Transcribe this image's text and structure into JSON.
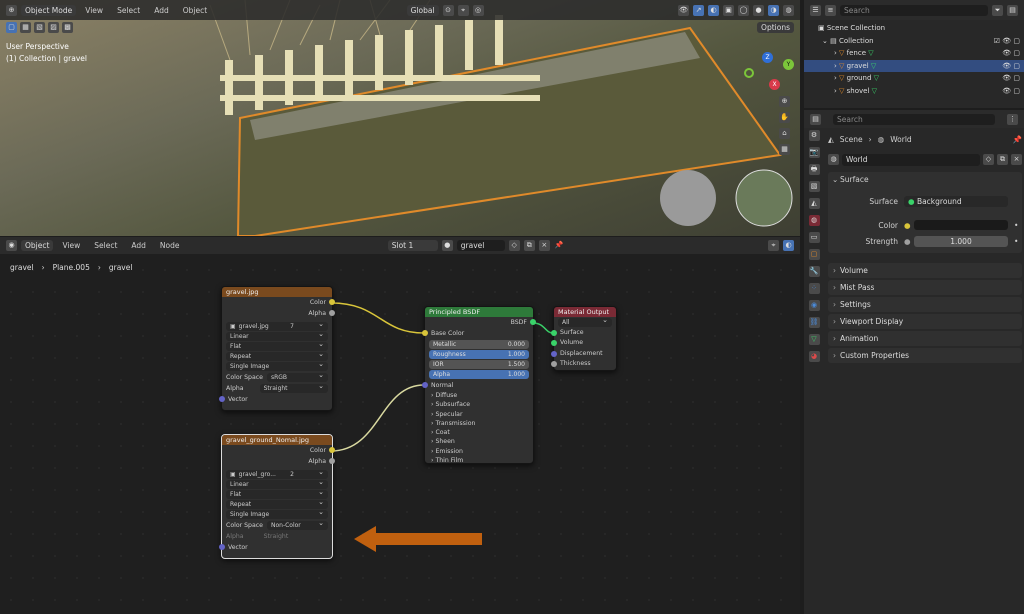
{
  "viewport": {
    "mode": "Object Mode",
    "menus": [
      "View",
      "Select",
      "Add",
      "Object"
    ],
    "transform": "Global",
    "options": "Options",
    "overlay_line1": "User Perspective",
    "overlay_line2": "(1) Collection | gravel",
    "gizmo": {
      "z": "Z",
      "y": "Y",
      "x": "X"
    }
  },
  "node_editor": {
    "editor_type": "Object",
    "menus": [
      "View",
      "Select",
      "Add",
      "Node"
    ],
    "slot": "Slot 1",
    "material": "gravel",
    "breadcrumb": [
      "gravel",
      "Plane.005",
      "gravel"
    ],
    "tex1": {
      "title": "gravel.jpg",
      "out_color": "Color",
      "out_alpha": "Alpha",
      "image": "gravel.jpg",
      "users": "7",
      "interp": "Linear",
      "proj": "Flat",
      "ext": "Repeat",
      "source": "Single Image",
      "cs_label": "Color Space",
      "cs": "sRGB",
      "alpha_label": "Alpha",
      "alpha": "Straight",
      "vector": "Vector"
    },
    "tex2": {
      "title": "gravel_ground_Nomal.jpg",
      "out_color": "Color",
      "out_alpha": "Alpha",
      "image": "gravel_gro...",
      "users": "2",
      "interp": "Linear",
      "proj": "Flat",
      "ext": "Repeat",
      "source": "Single Image",
      "cs_label": "Color Space",
      "cs": "Non-Color",
      "alpha_label": "Alpha",
      "alpha": "Straight",
      "vector": "Vector"
    },
    "bsdf": {
      "title": "Principled BSDF",
      "out": "BSDF",
      "base_color": "Base Color",
      "metallic": "Metallic",
      "metallic_v": "0.000",
      "roughness": "Roughness",
      "roughness_v": "1.000",
      "ior": "IOR",
      "ior_v": "1.500",
      "alpha": "Alpha",
      "alpha_v": "1.000",
      "normal": "Normal",
      "panels": [
        "Diffuse",
        "Subsurface",
        "Specular",
        "Transmission",
        "Coat",
        "Sheen",
        "Emission",
        "Thin Film"
      ]
    },
    "matout": {
      "title": "Material Output",
      "target": "All",
      "inputs": [
        "Surface",
        "Volume",
        "Displacement",
        "Thickness"
      ]
    },
    "logo": "blender"
  },
  "outliner": {
    "search": "Search",
    "scene_collection": "Scene Collection",
    "collection": "Collection",
    "items": [
      "fence",
      "gravel",
      "ground",
      "shovel"
    ]
  },
  "properties": {
    "search": "Search",
    "scene": "Scene",
    "world": "World",
    "world_name": "World",
    "surface_panel": "Surface",
    "surface_label": "Surface",
    "surface_value": "Background",
    "color_label": "Color",
    "strength_label": "Strength",
    "strength_value": "1.000",
    "panels": [
      "Volume",
      "Mist Pass",
      "Settings",
      "Viewport Display",
      "Animation",
      "Custom Properties"
    ]
  },
  "colors": {
    "accent": "#4772b3",
    "arrow": "#c0600f",
    "tex_header": "#7a4a1e",
    "bsdf_header": "#2e7a3a",
    "out_header": "#7a2a35"
  }
}
